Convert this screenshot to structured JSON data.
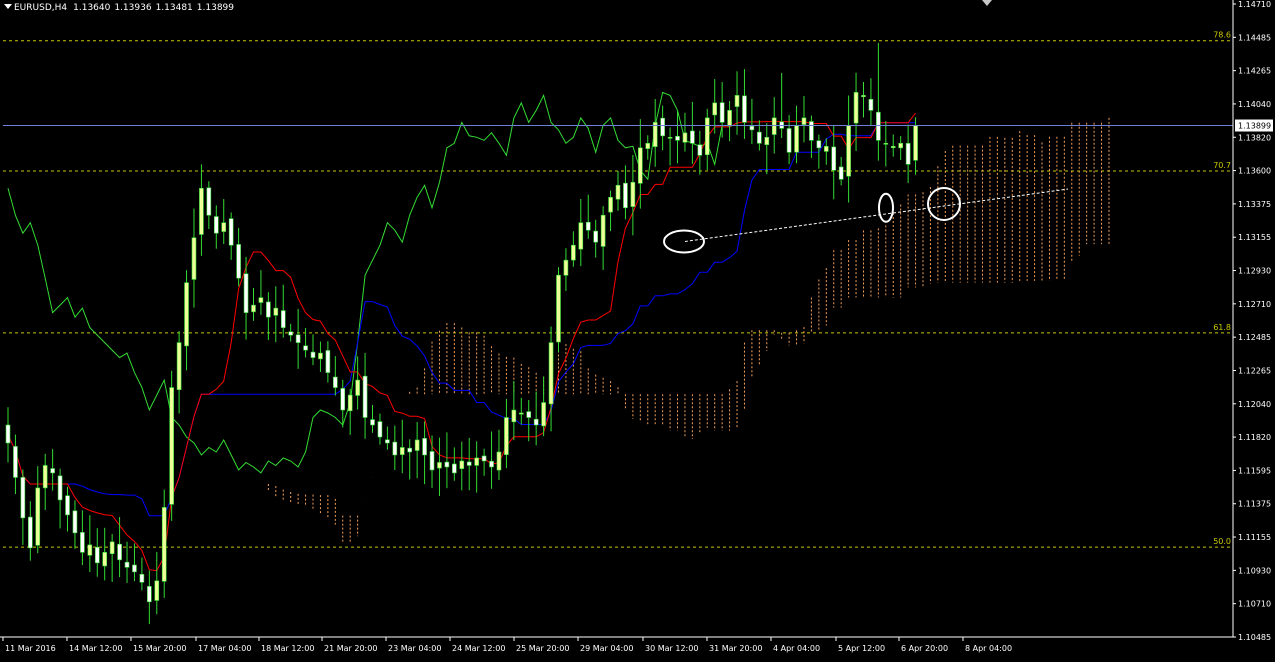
{
  "header": {
    "symbol_timeframe": "EURUSD,H4",
    "open": "1.13640",
    "high": "1.13936",
    "low": "1.13481",
    "close": "1.13899"
  },
  "colors": {
    "background": "#000000",
    "axis": "#ffffff",
    "bull_candle": "#eeff99",
    "bear_candle": "#ffffff",
    "wick": "#33dd33",
    "tenkan": "#ff0000",
    "kijun": "#0000ff",
    "chikou": "#33dd33",
    "kumo": "#f5a05a",
    "fibo": "#c8c800",
    "bid_line": "#6e7fd6",
    "trendline": "#ffffff",
    "annotation": "#ffffff"
  },
  "chart_data": {
    "type": "candlestick",
    "symbol": "EURUSD",
    "timeframe": "H4",
    "ylim": [
      1.10485,
      1.1471
    ],
    "price_ticks": [
      "1.14710",
      "1.14485",
      "1.14265",
      "1.14040",
      "1.13820",
      "1.13600",
      "1.13375",
      "1.13155",
      "1.12930",
      "1.12710",
      "1.12485",
      "1.12265",
      "1.12040",
      "1.11820",
      "1.11595",
      "1.11375",
      "1.11155",
      "1.10930",
      "1.10710",
      "1.10485"
    ],
    "x_ticks": [
      "11 Mar 2016",
      "14 Mar 12:00",
      "15 Mar 20:00",
      "17 Mar 04:00",
      "18 Mar 12:00",
      "21 Mar 20:00",
      "23 Mar 04:00",
      "24 Mar 12:00",
      "25 Mar 20:00",
      "29 Mar 04:00",
      "30 Mar 12:00",
      "31 Mar 20:00",
      "4 Apr 04:00",
      "5 Apr 12:00",
      "6 Apr 20:00",
      "8 Apr 04:00"
    ],
    "current_price": "1.13899",
    "fibo_levels": [
      {
        "label": "78.6",
        "price": 1.14465
      },
      {
        "label": "70.7",
        "price": 1.13595
      },
      {
        "label": "61.8",
        "price": 1.12515
      },
      {
        "label": "50.0",
        "price": 1.11085
      }
    ],
    "closes": [
      1.1178,
      1.1155,
      1.1128,
      1.1108,
      1.1148,
      1.1163,
      1.1158,
      1.114,
      1.113,
      1.1118,
      1.1105,
      1.111,
      1.1098,
      1.1105,
      1.1112,
      1.11,
      1.1095,
      1.1092,
      1.1085,
      1.1072,
      1.1086,
      1.1135,
      1.1215,
      1.1245,
      1.1285,
      1.1315,
      1.1348,
      1.133,
      1.1318,
      1.1325,
      1.131,
      1.1288,
      1.1265,
      1.127,
      1.1275,
      1.1262,
      1.1268,
      1.1255,
      1.125,
      1.1245,
      1.124,
      1.1235,
      1.1238,
      1.1225,
      1.1215,
      1.12,
      1.121,
      1.122,
      1.1195,
      1.119,
      1.1182,
      1.1178,
      1.117,
      1.1175,
      1.1172,
      1.118,
      1.117,
      1.116,
      1.1165,
      1.1162,
      1.1158,
      1.1166,
      1.1163,
      1.1168,
      1.1166,
      1.1162,
      1.1172,
      1.1195,
      1.12,
      1.1198,
      1.1195,
      1.119,
      1.1205,
      1.1245,
      1.129,
      1.13,
      1.131,
      1.1325,
      1.132,
      1.1312,
      1.133,
      1.1342,
      1.135,
      1.1335,
      1.1352,
      1.1375,
      1.1378,
      1.1392,
      1.1383,
      1.1382,
      1.138,
      1.1385,
      1.1378,
      1.137,
      1.1395,
      1.1405,
      1.1392,
      1.14,
      1.141,
      1.1392,
      1.1387,
      1.1378,
      1.1382,
      1.1395,
      1.1388,
      1.1372,
      1.139,
      1.1395,
      1.138,
      1.1375,
      1.1376,
      1.136,
      1.1354,
      1.139,
      1.1412,
      1.141,
      1.14,
      1.138,
      1.1378,
      1.1376,
      1.1378,
      1.1364,
      1.139
    ],
    "indicator": "Ichimoku Kinko Hyo",
    "annotations": [
      "ellipse at kijun touch 30 Mar",
      "ellipse at 5 Apr low",
      "ellipse at 6 Apr low",
      "ascending trendline"
    ]
  }
}
